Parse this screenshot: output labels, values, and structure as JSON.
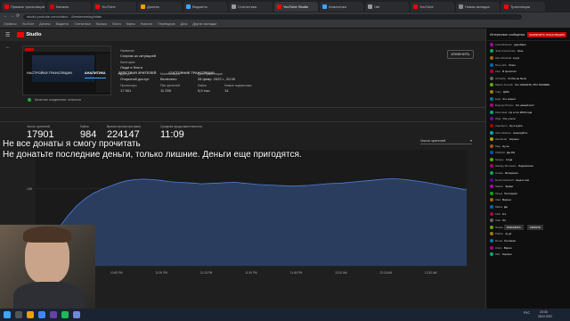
{
  "browser": {
    "tabs": [
      {
        "label": "Прямые трансляции - YouTube Studio",
        "color": "#ff0000",
        "active": false
      },
      {
        "label": "Каналы",
        "color": "#c00",
        "active": false
      },
      {
        "label": "YouTube",
        "color": "#ff0000",
        "active": false
      },
      {
        "label": "Донаты",
        "color": "#f90",
        "active": false
      },
      {
        "label": "Виджеты",
        "color": "#3ea6ff",
        "active": false
      },
      {
        "label": "Статистика",
        "color": "#999",
        "active": false
      },
      {
        "label": "YouTube Studio",
        "color": "#ff0000",
        "active": true
      },
      {
        "label": "Аналитика",
        "color": "#3ea6ff",
        "active": false
      },
      {
        "label": "Чат",
        "color": "#999",
        "active": false
      },
      {
        "label": "YouTube",
        "color": "#ff0000",
        "active": false
      },
      {
        "label": "Новая вкладка",
        "color": "#888",
        "active": false
      },
      {
        "label": "Трансляция",
        "color": "#ff0000",
        "active": false
      }
    ],
    "url": "studio.youtube.com/video/.../livestreaming/stats",
    "bookmarks": [
      "Сервисы",
      "YouTube",
      "Донаты",
      "Виджеты",
      "Статистика",
      "Музыка",
      "Почта",
      "Карты",
      "Новости",
      "Переводчик",
      "Диск",
      "Другие закладки"
    ]
  },
  "studio": {
    "logo": "Studio",
    "stream": {
      "section_title": "Название",
      "title": "Спорим за ситуацией",
      "category_label": "Категория",
      "category": "Люди и блоги",
      "privacy_label": "Доступ",
      "privacy": "Открытый доступ",
      "monetization_label": "Монетизация",
      "monetization": "Включено",
      "date_label": "Дата трансляции",
      "date": "28 февр. 2022 г., 20:30",
      "views_label": "Просмотры",
      "views": "17 901",
      "peak_label": "Пик зрителей",
      "peak": "11 250",
      "likes_label": "Лайки",
      "likes": "5,5 тыс.",
      "new_subs_label": "Новые подписчики",
      "new_subs": "14",
      "edit_button": "ИЗМЕНИТЬ",
      "quality_text": "Качество соединения: отличное"
    },
    "tabs": [
      "НАСТРОЙКИ ТРАНСЛЯЦИИ",
      "АНАЛИТИКА",
      "ДЕЙСТВИЯ ЗРИТЕЛЕЙ",
      "СОСТОЯНИЕ ТРАНСЛЯЦИИ"
    ],
    "active_tab": 1,
    "metrics": [
      {
        "label": "Число зрителей",
        "value": "17901"
      },
      {
        "label": "Лайки",
        "value": "984"
      },
      {
        "label": "Время просмотра (мин)",
        "value": "224147"
      },
      {
        "label": "Средняя продолжительность",
        "value": "11:09"
      }
    ],
    "chart_selector": "Число зрителей",
    "overlay": {
      "line1": "Не все донаты я смогу прочитать",
      "line2": "Не донатьте последние деньги, только лишние. Деньги еще пригодятся."
    }
  },
  "chart_data": {
    "type": "area",
    "ylabel": "",
    "y_tick_labels": [
      "10K",
      "0"
    ],
    "x_tick_labels": [
      "10:30 PM",
      "10:45 PM",
      "11:00 PM",
      "11:15 PM",
      "11:30 PM",
      "11:45 PM",
      "12:00 AM",
      "12:15 AM",
      "12:30 AM"
    ],
    "values": [
      0,
      1800,
      3600,
      5200,
      6600,
      7800,
      8700,
      9400,
      9900,
      10300,
      10700,
      11000,
      11150,
      11200,
      11150,
      11050,
      10900,
      10800,
      10750,
      10700,
      10600,
      10650,
      10700,
      10750,
      10800,
      10700,
      10600,
      10500,
      10450,
      10400,
      10350,
      10300,
      10350,
      10400,
      10500,
      10600,
      10650,
      10700,
      10800,
      10900,
      11000,
      11100,
      11200,
      11250,
      11200,
      11100,
      10950,
      10800,
      10600,
      10400,
      10200,
      10000,
      9800
    ],
    "ylim": [
      0,
      15000
    ],
    "colors": {
      "line": "#4a7fd9",
      "fill": "#2b3d5e"
    }
  },
  "chat": {
    "header": "Интересные сообщения",
    "donate_button": "ЗАКРЕПИТЬ ТРАНСЛЯЦИЮ",
    "messages": [
      {
        "author": "Lisa Mickeson",
        "text": "дороЗаря",
        "color": "#a0a"
      },
      {
        "author": "Julia Kravchenko",
        "text": "боль",
        "color": "#0a6"
      },
      {
        "author": "Alex Marshall",
        "text": "в ряд",
        "color": "#a60"
      },
      {
        "author": "Drux pink",
        "text": "Ответ",
        "color": "#06a"
      },
      {
        "author": "Irina",
        "text": "Я прочитал",
        "color": "#a04"
      },
      {
        "author": "Artmathy",
        "text": "Чтобы не было",
        "color": "#666"
      },
      {
        "author": "Maxim Zvezdin",
        "text": "Кот СКАЗАТЬ ЧТО ХОЗЯИН",
        "color": "#6a0"
      },
      {
        "author": "Yuriy",
        "text": "ДОМ",
        "color": "#a70"
      },
      {
        "author": "Ещё",
        "text": "Что значит",
        "color": "#07a"
      },
      {
        "author": "Evgeniy Klimov",
        "text": "Я и новый пост",
        "color": "#a07"
      },
      {
        "author": "Светлана",
        "text": "Ну а что 2016 года",
        "color": "#0a7"
      },
      {
        "author": "Olga",
        "text": "Что у него",
        "color": "#70a"
      },
      {
        "author": "Аэрофлот",
        "text": "Ну в курсе",
        "color": "#a00"
      },
      {
        "author": "Irina Vasileva",
        "text": "пожалуйста",
        "color": "#0aa"
      },
      {
        "author": "Alexander",
        "text": "Хорошо",
        "color": "#aa0"
      },
      {
        "author": "Mag",
        "text": "Ну не",
        "color": "#a50"
      },
      {
        "author": "CMOCK",
        "text": "Да 3%",
        "color": "#05a"
      },
      {
        "author": "Sergey",
        "text": "Когда",
        "color": "#5a0"
      },
      {
        "author": "Nikolay Zhuravlev",
        "text": "Подписался",
        "color": "#a05"
      },
      {
        "author": "Алина",
        "text": "Интересно",
        "color": "#0a5"
      },
      {
        "author": "Denis Pavlovich",
        "text": "Ещё в том",
        "color": "#50a"
      },
      {
        "author": "Sasha",
        "text": "Привет",
        "color": "#a0a"
      },
      {
        "author": "Tanya",
        "text": "Тестируем",
        "color": "#0a0"
      },
      {
        "author": "Vlad",
        "text": "Вопрос",
        "color": "#a60"
      },
      {
        "author": "Misha",
        "text": "Да",
        "color": "#06a"
      },
      {
        "author": "Kirill",
        "text": "Ага",
        "color": "#a04"
      },
      {
        "author": "Stas",
        "text": "Оо",
        "color": "#666"
      },
      {
        "author": "Nadya",
        "text": "Спасибо",
        "color": "#6a0"
      },
      {
        "author": "Pasha",
        "text": "Ну да",
        "color": "#a70"
      },
      {
        "author": "Roma",
        "text": "Согласен",
        "color": "#07a"
      },
      {
        "author": "Anton",
        "text": "Верно",
        "color": "#a07"
      },
      {
        "author": "Max",
        "text": "Хорошо",
        "color": "#0a7"
      }
    ],
    "show_more": "ПОКАЗАТЬ",
    "hide": "СКРЫТЬ"
  },
  "taskbar": {
    "time": "23:34",
    "date": "28.02.2022",
    "lang": "РУС"
  }
}
